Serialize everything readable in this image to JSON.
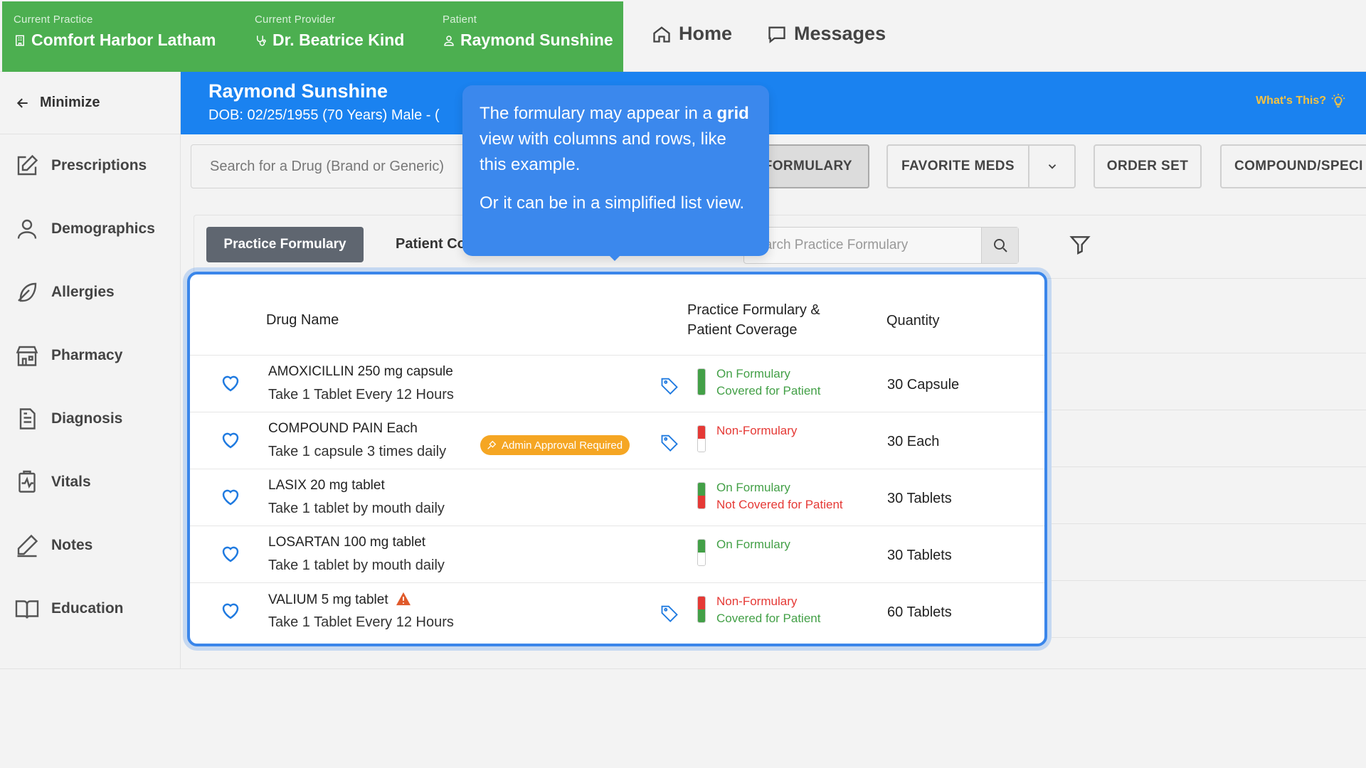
{
  "context": {
    "practice_label": "Current Practice",
    "practice_value": "Comfort Harbor Latham",
    "provider_label": "Current Provider",
    "provider_value": "Dr. Beatrice Kind",
    "patient_label": "Patient",
    "patient_value": "Raymond Sunshine"
  },
  "topnav": {
    "home": "Home",
    "messages": "Messages"
  },
  "sidebar": {
    "minimize": "Minimize",
    "items": [
      {
        "label": "Prescriptions",
        "icon": "edit-icon"
      },
      {
        "label": "Demographics",
        "icon": "person-icon"
      },
      {
        "label": "Allergies",
        "icon": "feather-icon"
      },
      {
        "label": "Pharmacy",
        "icon": "store-icon"
      },
      {
        "label": "Diagnosis",
        "icon": "document-icon"
      },
      {
        "label": "Vitals",
        "icon": "clipboard-pulse-icon"
      },
      {
        "label": "Notes",
        "icon": "pen-icon"
      },
      {
        "label": "Education",
        "icon": "book-icon"
      }
    ]
  },
  "banner": {
    "name": "Raymond Sunshine",
    "dob": "DOB: 02/25/1955 (70 Years) Male - (",
    "whats_this": "What's This?",
    "color": "#1a82f0"
  },
  "toolbar": {
    "search_placeholder": "Search for a Drug (Brand or Generic)",
    "formulary": "FORMULARY",
    "favorite_meds": "FAVORITE MEDS",
    "order_set": "ORDER SET",
    "compound": "COMPOUND/SPECI"
  },
  "formulary_panel": {
    "practice_tab": "Practice Formulary",
    "patient_tab": "Patient Co",
    "search_placeholder": "earch Practice Formulary"
  },
  "table": {
    "headers": {
      "drug_name": "Drug Name",
      "coverage_line1": "Practice Formulary &",
      "coverage_line2": "Patient Coverage",
      "quantity": "Quantity"
    },
    "rows": [
      {
        "name": "AMOXICILLIN",
        "strength": "250 mg capsule",
        "sig": "Take 1 Tablet Every 12 Hours",
        "badge": "",
        "tag": true,
        "bar_top": "#43a047",
        "bar_bottom": "#43a047",
        "cov1": "On Formulary",
        "cov1_status": "g",
        "cov2": "Covered for Patient",
        "cov2_status": "g",
        "qty": "30 Capsule"
      },
      {
        "name": "COMPOUND PAIN",
        "strength": "Each",
        "sig": "Take 1 capsule 3 times daily",
        "badge": "Admin Approval Required",
        "tag": true,
        "bar_top": "#e53935",
        "bar_bottom": "#ffffff",
        "cov1": "Non-Formulary",
        "cov1_status": "r",
        "cov2": "",
        "cov2_status": "g",
        "qty": "30 Each"
      },
      {
        "name": "LASIX",
        "strength": "20 mg tablet",
        "sig": "Take 1 tablet by mouth daily",
        "badge": "",
        "tag": false,
        "bar_top": "#43a047",
        "bar_bottom": "#e53935",
        "cov1": "On Formulary",
        "cov1_status": "g",
        "cov2": "Not Covered for Patient",
        "cov2_status": "r",
        "qty": "30 Tablets"
      },
      {
        "name": "LOSARTAN",
        "strength": "100 mg tablet",
        "sig": "Take 1 tablet by mouth daily",
        "badge": "",
        "tag": false,
        "bar_top": "#43a047",
        "bar_bottom": "#ffffff",
        "cov1": "On Formulary",
        "cov1_status": "g",
        "cov2": "",
        "cov2_status": "g",
        "qty": "30 Tablets"
      },
      {
        "name": "VALIUM",
        "strength": "5 mg tablet",
        "sig": "Take 1 Tablet Every 12 Hours",
        "badge": "",
        "tag": true,
        "warning": true,
        "bar_top": "#e53935",
        "bar_bottom": "#43a047",
        "cov1": "Non-Formulary",
        "cov1_status": "r",
        "cov2": "Covered for Patient",
        "cov2_status": "g",
        "qty": "60 Tablets"
      }
    ]
  },
  "tooltip": {
    "line1_a": "The formulary may appear in a",
    "line1_bold": "grid",
    "line1_b": "view with columns and rows, like this example.",
    "line2": "Or it can be in a simplified list view."
  },
  "colors": {
    "context_green": "#4caf50",
    "accent_blue": "#3a86ea",
    "on_formulary": "#43a047",
    "non_formulary": "#e53935",
    "badge_orange": "#f5a623"
  }
}
